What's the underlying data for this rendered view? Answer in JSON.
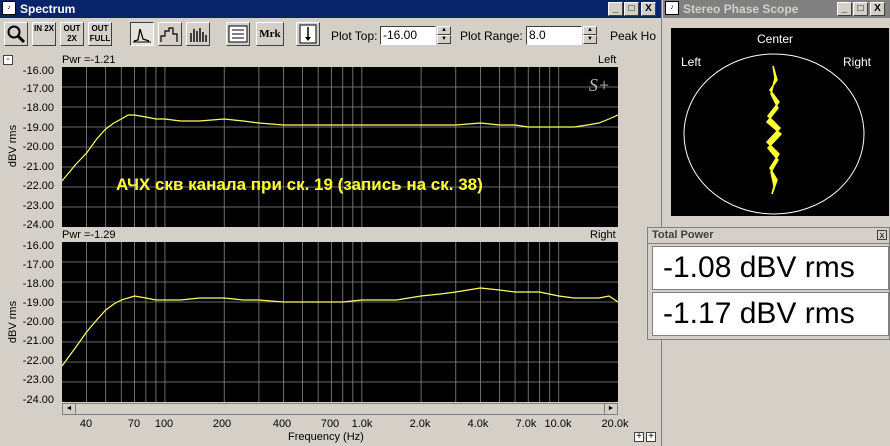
{
  "spectrum": {
    "title": "Spectrum",
    "plot_top_label": "Plot Top:",
    "plot_top_value": "-16.00",
    "plot_range_label": "Plot Range:",
    "plot_range_value": "8.0",
    "peak_hold_label": "Peak Ho",
    "zoom_buttons": [
      "IN 2X",
      "OUT 2X",
      "OUT FULL"
    ],
    "mrk_label": "Mrk",
    "collapse_glyph": "-",
    "y_axis_label": "dBV rms",
    "x_axis_label": "Frequency (Hz)",
    "logo_text": "S+",
    "annotation": "АЧХ скв канала при ск. 19 (запись на ск. 38)",
    "y_ticks": [
      "-16.00",
      "-17.00",
      "-18.00",
      "-19.00",
      "-20.00",
      "-21.00",
      "-22.00",
      "-23.00",
      "-24.00"
    ],
    "x_ticks": [
      "40",
      "70",
      "100",
      "200",
      "400",
      "700",
      "1.0k",
      "2.0k",
      "4.0k",
      "7.0k",
      "10.0k",
      "20.0k"
    ],
    "top_panel": {
      "pwr": "Pwr =-1.21",
      "channel": "Left"
    },
    "bottom_panel": {
      "pwr": "Pwr =-1.29",
      "channel": "Right"
    },
    "window_buttons": [
      "_",
      "□",
      "X"
    ],
    "zoom_glyphs": [
      "+",
      "+"
    ]
  },
  "phase_scope": {
    "title": "Stereo Phase Scope",
    "center_label": "Center",
    "left_label": "Left",
    "right_label": "Right",
    "window_buttons": [
      "_",
      "□",
      "X"
    ]
  },
  "total_power": {
    "title": "Total Power",
    "close_glyph": "x",
    "rows": [
      "-1.08 dBV rms",
      "-1.17 dBV rms"
    ]
  },
  "colors": {
    "trace": "#ffff66",
    "grid": "#8a8a8a",
    "plot_bg": "#000000",
    "annotation": "#ffff33",
    "titlebar": "#0a246a"
  },
  "chart_data": [
    {
      "type": "line",
      "title": "",
      "xlabel": "Frequency (Hz)",
      "ylabel": "dBV rms",
      "x_scale": "log",
      "xlim": [
        30,
        20000
      ],
      "ylim": [
        -24,
        -16
      ],
      "grid": true,
      "channel": "Left",
      "annotation": "Pwr =-1.21",
      "series": [
        {
          "x": [
            30,
            35,
            40,
            45,
            50,
            55,
            60,
            65,
            70,
            80,
            90,
            100,
            120,
            150,
            200,
            250,
            300,
            400,
            500,
            600,
            700,
            800,
            1000,
            1200,
            1500,
            2000,
            2500,
            3000,
            4000,
            5000,
            6000,
            7000,
            8000,
            10000,
            12000,
            14000,
            16000,
            18000,
            20000
          ],
          "y": [
            -21.7,
            -20.9,
            -20.3,
            -19.6,
            -19.1,
            -18.8,
            -18.6,
            -18.4,
            -18.4,
            -18.5,
            -18.6,
            -18.6,
            -18.7,
            -18.7,
            -18.6,
            -18.7,
            -18.8,
            -18.9,
            -18.9,
            -18.9,
            -18.9,
            -18.9,
            -18.9,
            -18.9,
            -18.9,
            -18.9,
            -18.9,
            -18.9,
            -18.8,
            -18.9,
            -18.9,
            -19.0,
            -19.0,
            -19.0,
            -19.0,
            -18.9,
            -18.8,
            -18.6,
            -18.4
          ]
        }
      ]
    },
    {
      "type": "line",
      "title": "",
      "xlabel": "Frequency (Hz)",
      "ylabel": "dBV rms",
      "x_scale": "log",
      "xlim": [
        30,
        20000
      ],
      "ylim": [
        -24,
        -16
      ],
      "grid": true,
      "channel": "Right",
      "annotation": "Pwr =-1.29",
      "series": [
        {
          "x": [
            30,
            35,
            40,
            45,
            50,
            55,
            60,
            65,
            70,
            80,
            90,
            100,
            120,
            150,
            200,
            250,
            300,
            400,
            500,
            600,
            700,
            800,
            1000,
            1200,
            1500,
            2000,
            2500,
            3000,
            4000,
            5000,
            6000,
            7000,
            8000,
            10000,
            12000,
            14000,
            16000,
            18000,
            20000
          ],
          "y": [
            -22.2,
            -21.3,
            -20.5,
            -19.9,
            -19.4,
            -19.1,
            -18.9,
            -18.8,
            -18.7,
            -18.8,
            -18.9,
            -18.9,
            -18.9,
            -18.8,
            -18.8,
            -18.9,
            -18.9,
            -19.0,
            -19.0,
            -19.0,
            -19.0,
            -19.0,
            -18.9,
            -18.9,
            -18.9,
            -18.7,
            -18.6,
            -18.5,
            -18.3,
            -18.4,
            -18.5,
            -18.5,
            -18.5,
            -18.7,
            -18.8,
            -18.8,
            -18.8,
            -18.7,
            -19.0
          ]
        }
      ]
    }
  ]
}
